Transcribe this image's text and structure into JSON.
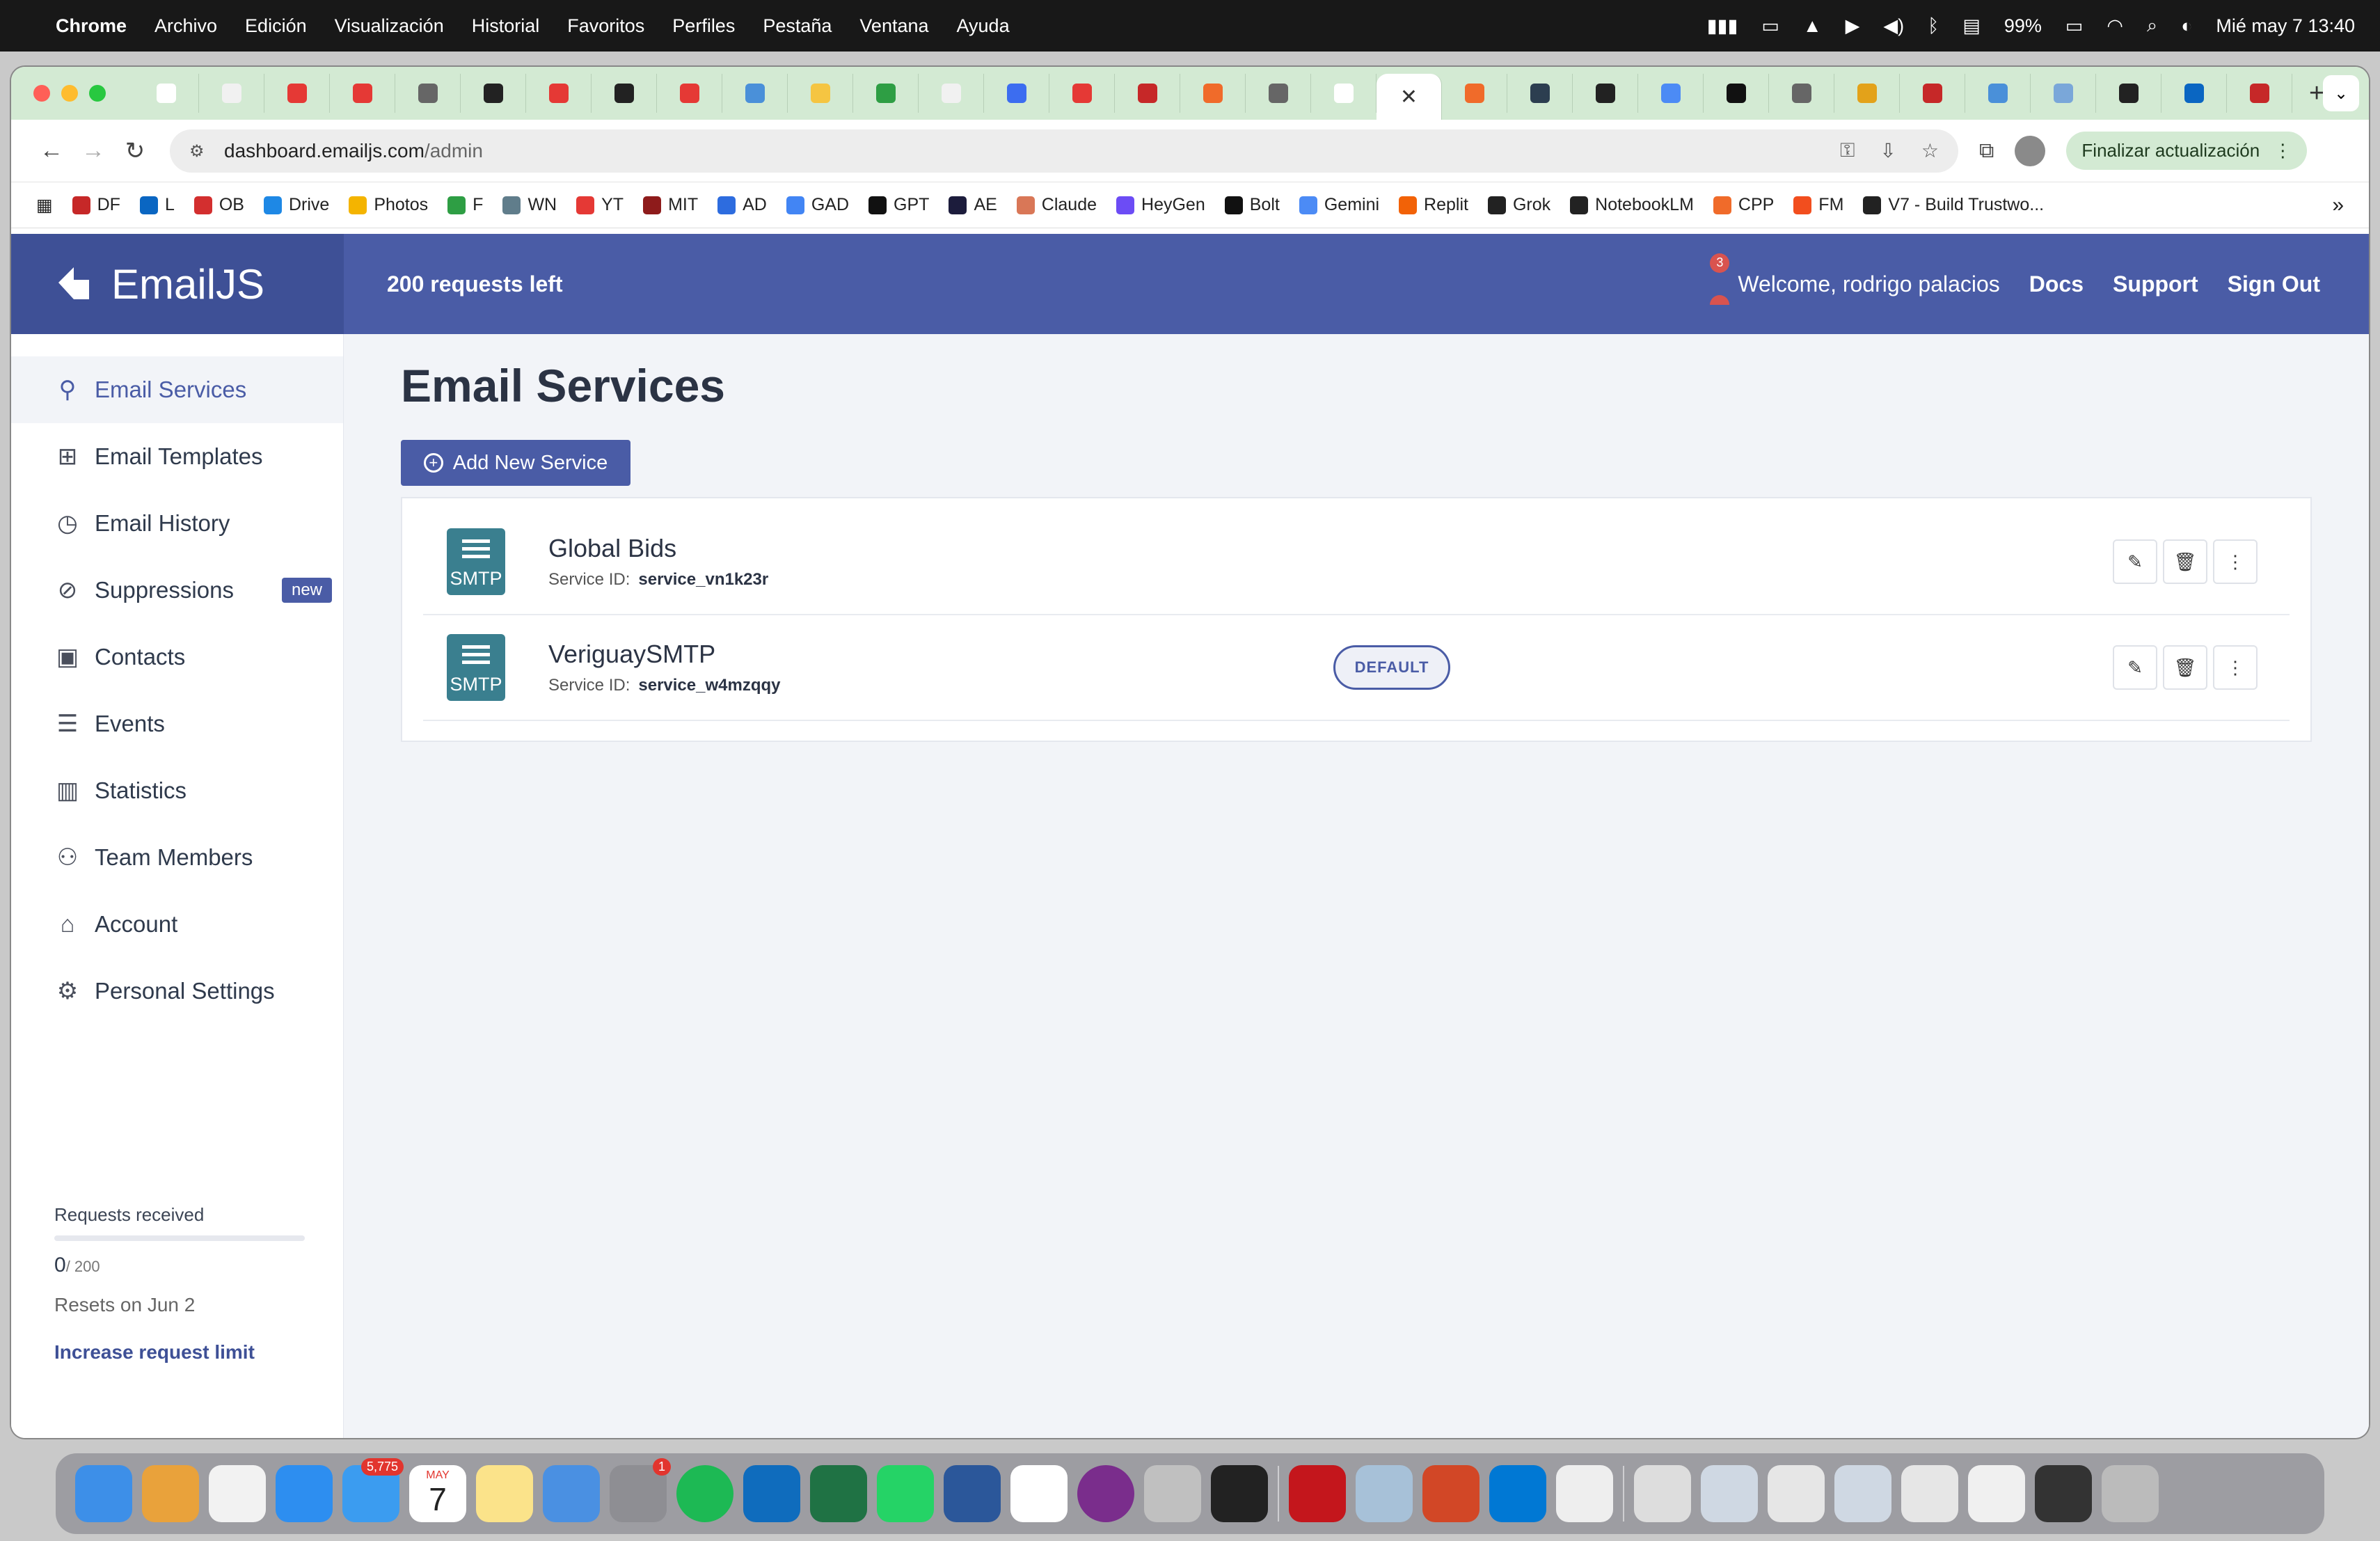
{
  "menubar": {
    "apple_icon": "apple-logo-icon",
    "app_name": "Chrome",
    "menus": [
      "Archivo",
      "Edición",
      "Visualización",
      "Historial",
      "Favoritos",
      "Perfiles",
      "Pestaña",
      "Ventana",
      "Ayuda"
    ],
    "battery": "99%",
    "datetime": "Mié may 7  13:40"
  },
  "browser": {
    "tab_colors": [
      "#ffffff",
      "#f1f1f1",
      "#e53935",
      "#e53935",
      "#666666",
      "#222222",
      "#e53935",
      "#222222",
      "#e53935",
      "#4a90d9",
      "#f5c542",
      "#2e9e44",
      "#f1f1f1",
      "#3c6df0",
      "#e53935",
      "#c62828",
      "#f06b2a",
      "#666666",
      "#ffffff",
      "#f06b2a",
      "#2c3e50",
      "#222222",
      "#4c8bf5",
      "#111111",
      "#666666",
      "#e3a21a",
      "#c62828",
      "#4a90d9",
      "#7aa7d9",
      "#222222",
      "#0a66c2",
      "#c62828"
    ],
    "active_tab_icon": "close-icon",
    "url_host": "dashboard.emailjs.com",
    "url_path": "/admin",
    "update_button": "Finalizar actualización",
    "bookmarks": [
      {
        "label": "DF",
        "color": "#c62828"
      },
      {
        "label": "L",
        "color": "#0a66c2"
      },
      {
        "label": "OB",
        "color": "#d32f2f"
      },
      {
        "label": "Drive",
        "color": "#1e88e5"
      },
      {
        "label": "Photos",
        "color": "#f4b400"
      },
      {
        "label": "F",
        "color": "#2e9e44"
      },
      {
        "label": "WN",
        "color": "#607d8b"
      },
      {
        "label": "YT",
        "color": "#e53935"
      },
      {
        "label": "MIT",
        "color": "#8e1b1b"
      },
      {
        "label": "AD",
        "color": "#2d6cdf"
      },
      {
        "label": "GAD",
        "color": "#4285f4"
      },
      {
        "label": "GPT",
        "color": "#111111"
      },
      {
        "label": "AE",
        "color": "#1c1c3c"
      },
      {
        "label": "Claude",
        "color": "#d97757"
      },
      {
        "label": "HeyGen",
        "color": "#6c4cf5"
      },
      {
        "label": "Bolt",
        "color": "#111111"
      },
      {
        "label": "Gemini",
        "color": "#4c8bf5"
      },
      {
        "label": "Replit",
        "color": "#f26207"
      },
      {
        "label": "Grok",
        "color": "#222222"
      },
      {
        "label": "NotebookLM",
        "color": "#222222"
      },
      {
        "label": "CPP",
        "color": "#f06b2a"
      },
      {
        "label": "FM",
        "color": "#f24e1e"
      },
      {
        "label": "V7 - Build Trustwo...",
        "color": "#222222"
      }
    ]
  },
  "app": {
    "brand": "EmailJS",
    "requests_left": "200 requests left",
    "notification_count": "3",
    "welcome_label": "Welcome,",
    "user_name": "rodrigo palacios",
    "docs": "Docs",
    "support": "Support",
    "sign_out": "Sign Out",
    "nav": [
      {
        "label": "Email Services",
        "icon": "plug-icon",
        "active": true
      },
      {
        "label": "Email Templates",
        "icon": "templates-icon"
      },
      {
        "label": "Email History",
        "icon": "history-icon"
      },
      {
        "label": "Suppressions",
        "icon": "ban-icon",
        "badge": "new"
      },
      {
        "label": "Contacts",
        "icon": "contacts-icon"
      },
      {
        "label": "Events",
        "icon": "list-icon"
      },
      {
        "label": "Statistics",
        "icon": "chart-icon"
      },
      {
        "label": "Team Members",
        "icon": "team-icon"
      },
      {
        "label": "Account",
        "icon": "bank-icon"
      },
      {
        "label": "Personal Settings",
        "icon": "gear-icon"
      }
    ],
    "requests": {
      "label": "Requests received",
      "used": "0",
      "limit": "/ 200",
      "used_fraction": 0,
      "resets": "Resets on Jun 2",
      "increase": "Increase request limit"
    },
    "page_title": "Email Services",
    "add_button": "Add New Service",
    "service_id_label": "Service ID:",
    "services": [
      {
        "name": "Global Bids",
        "id": "service_vn1k23r",
        "type": "SMTP"
      },
      {
        "name": "VeriguaySMTP",
        "id": "service_w4mzqqy",
        "type": "SMTP",
        "badge": "DEFAULT"
      }
    ]
  }
}
